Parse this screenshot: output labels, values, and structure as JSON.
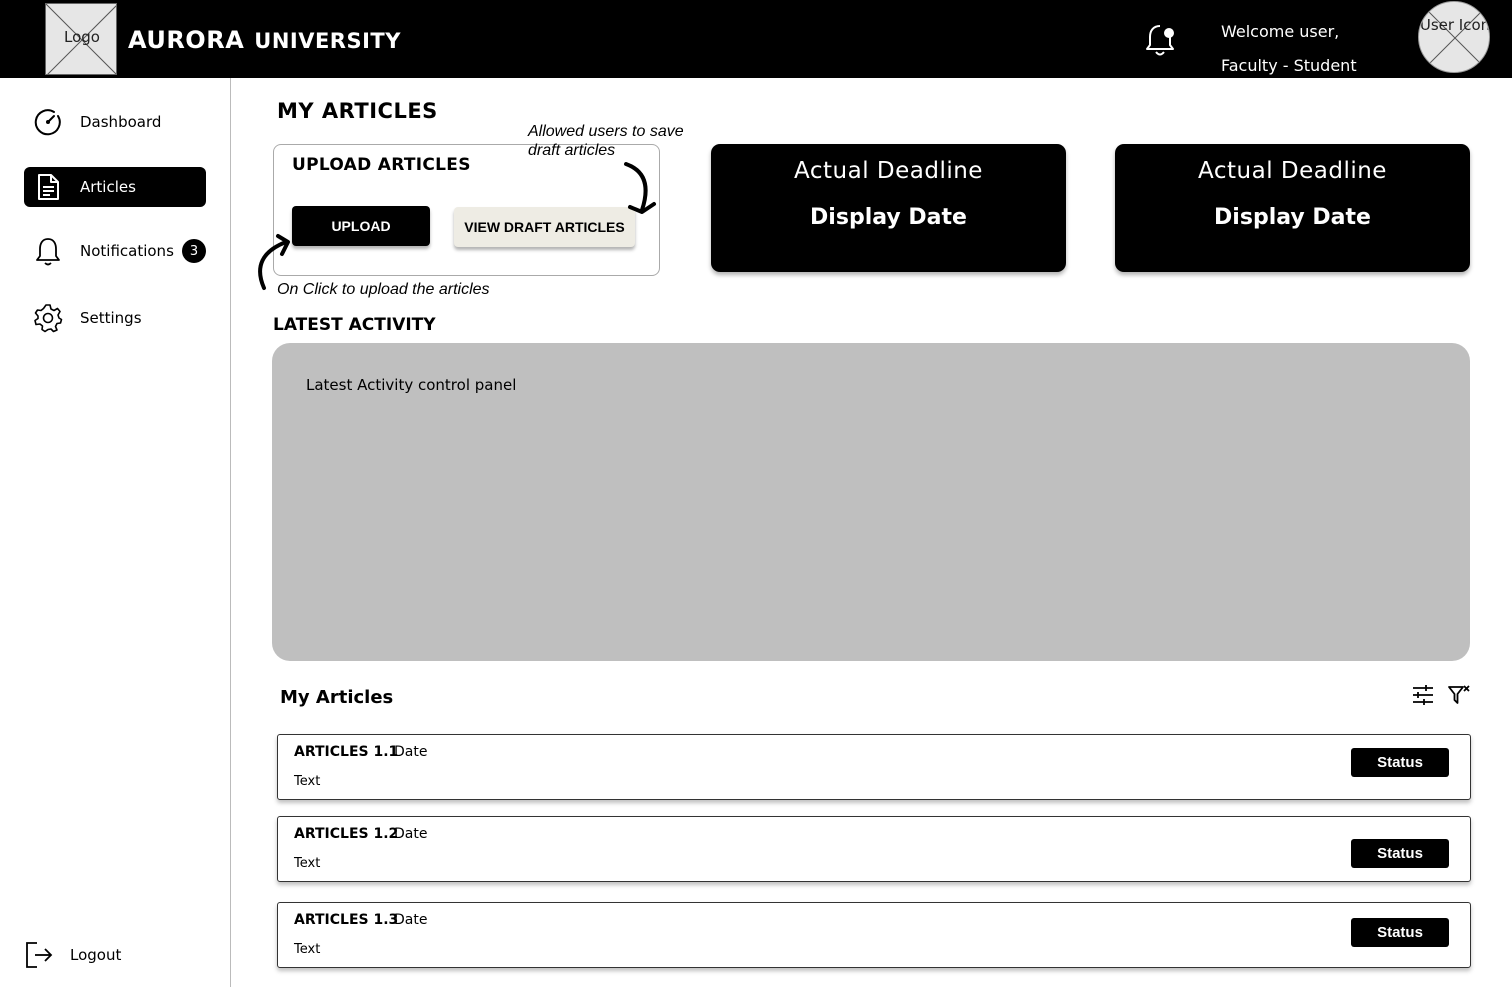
{
  "header": {
    "logo_label": "Logo",
    "brand_primary": "AURORA",
    "brand_secondary": "UNIVERSITY",
    "welcome_line1": "Welcome user,",
    "welcome_line2": "Faculty - Student",
    "user_icon_label": "User Icon"
  },
  "sidebar": {
    "items": [
      {
        "label": "Dashboard",
        "icon": "gauge-icon",
        "active": false
      },
      {
        "label": "Articles",
        "icon": "document-icon",
        "active": true
      },
      {
        "label": "Notifications",
        "icon": "bell-icon",
        "active": false,
        "badge": "3"
      },
      {
        "label": "Settings",
        "icon": "gear-icon",
        "active": false
      }
    ],
    "logout_label": "Logout"
  },
  "main": {
    "page_title": "MY ARTICLES",
    "upload": {
      "title": "UPLOAD ARTICLES",
      "upload_button": "UPLOAD",
      "draft_button": "VIEW DRAFT ARTICLES",
      "draft_note": "Allowed users to save draft articles",
      "upload_note": "On Click to upload the articles"
    },
    "deadlines": [
      {
        "line1": "Actual  Deadline",
        "line2": "Display Date"
      },
      {
        "line1": "Actual  Deadline",
        "line2": "Display Date"
      }
    ],
    "activity": {
      "title": "LATEST ACTIVITY",
      "panel_text": "Latest Activity control panel"
    },
    "articles": {
      "title": "My Articles",
      "tools": [
        "sliders-icon",
        "filter-clear-icon"
      ],
      "items": [
        {
          "name": "ARTICLES 1.1",
          "date": "Date",
          "text": "Text",
          "status": "Status"
        },
        {
          "name": "ARTICLES 1.2",
          "date": "Date",
          "text": "Text",
          "status": "Status"
        },
        {
          "name": "ARTICLES 1.3",
          "date": "Date",
          "text": "Text",
          "status": "Status"
        }
      ]
    }
  },
  "colors": {
    "header_bg": "#000000",
    "active_nav": "#000000",
    "panel_gray": "#bfbfbf",
    "draft_button_bg": "#eeece4"
  }
}
